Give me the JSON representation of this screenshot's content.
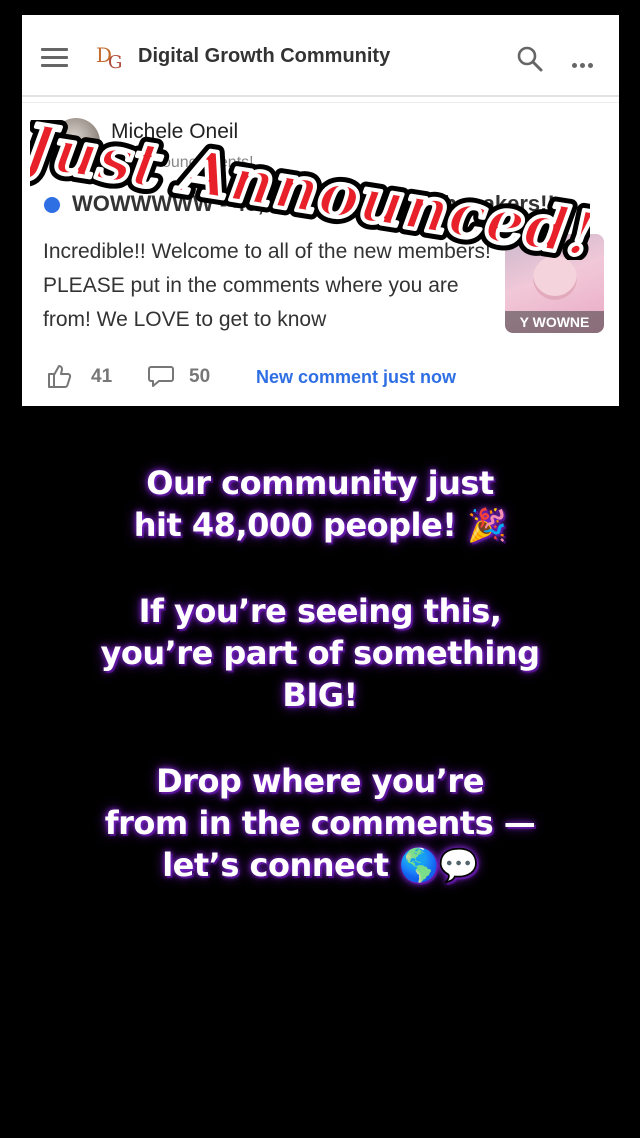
{
  "app": {
    "logo_text": "DG",
    "title": "Digital Growth Community"
  },
  "icons": {
    "menu": "hamburger-menu-icon",
    "search": "search-icon",
    "more": "more-horizontal-icon",
    "like": "thumbs-up-icon",
    "comment": "comment-bubble-icon"
  },
  "post": {
    "author": "Michele Oneil",
    "meta": "2 • Announcements!",
    "title": "WOWWWWW - 48,000 Digital Growth makers!!",
    "body": "Incredible!! Welcome to all of the new members! PLEASE put in the comments where you are from! We LOVE to get to know",
    "thumbnail_caption": "Y WOWNE",
    "likes": "41",
    "comments": "50",
    "new_comment_label": "New comment just now"
  },
  "overlay": {
    "stamp_text": "Just Announced!",
    "caption": {
      "p1_line1": "Our community just",
      "p1_line2": "hit 48,000 people! 🎉",
      "p2_line1": "If you’re seeing this,",
      "p2_line2": "you’re part of something",
      "p2_line3": "BIG!",
      "p3_line1": "Drop where you’re",
      "p3_line2": "from in the comments —",
      "p3_line3": "let’s connect 🌎💬"
    }
  },
  "colors": {
    "accent_blue": "#2f6fe4",
    "stamp_red": "#e8202a",
    "glow_purple": "#8a2be2",
    "background": "#000000"
  }
}
